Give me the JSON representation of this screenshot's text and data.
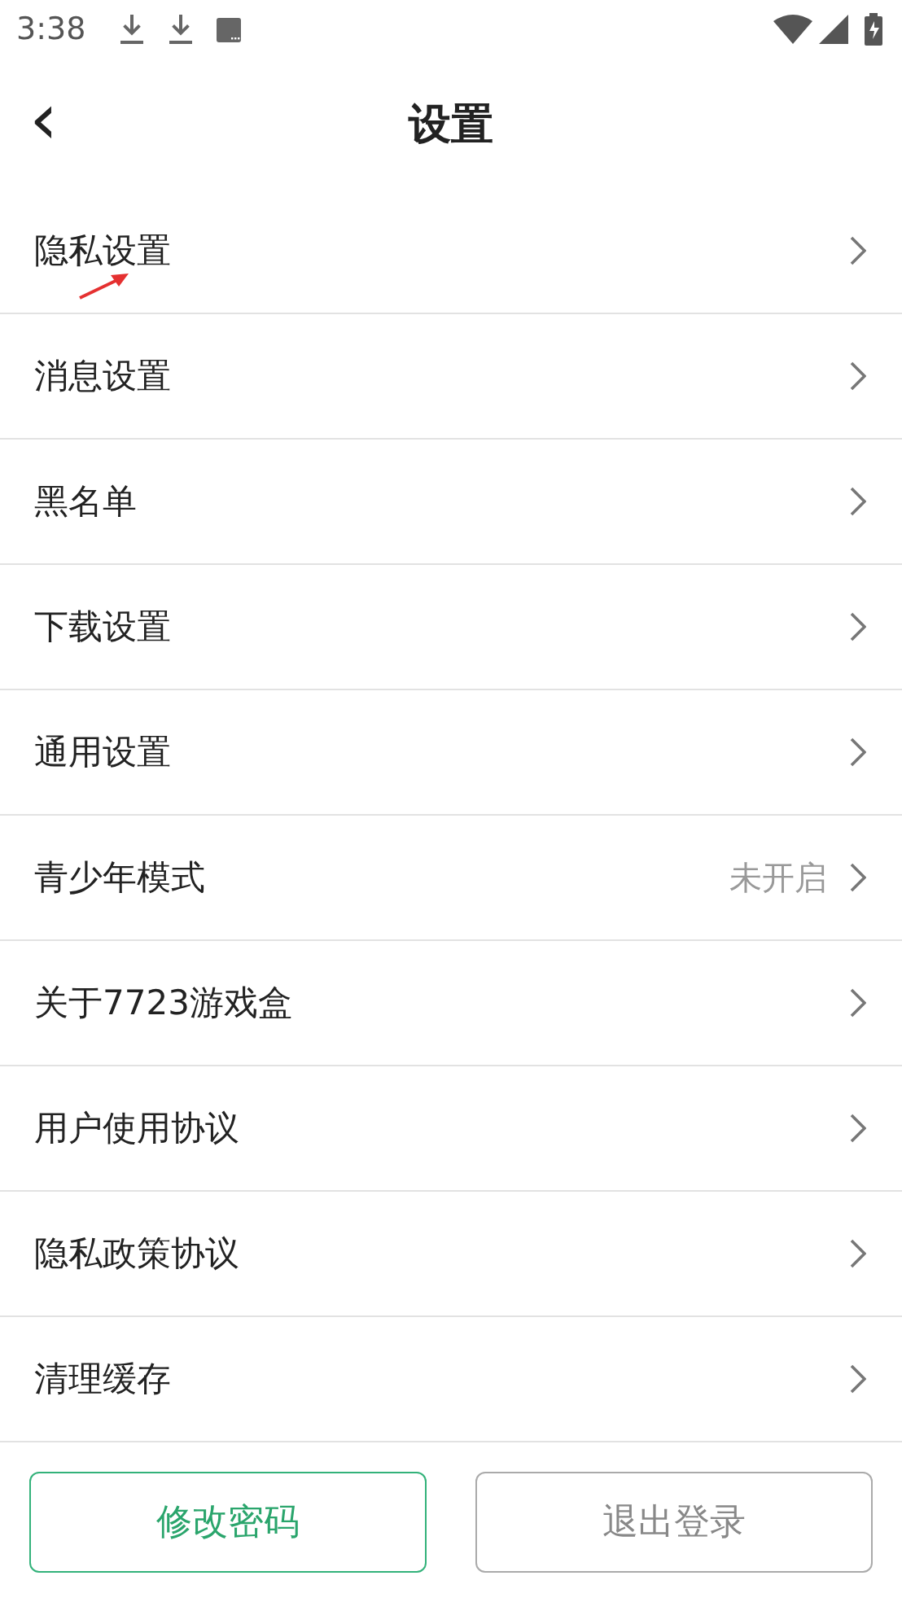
{
  "status_bar": {
    "time": "3:38"
  },
  "header": {
    "back": "‹",
    "title": "设置"
  },
  "items": [
    {
      "label": "隐私设置",
      "annotated": true
    },
    {
      "label": "消息设置",
      "annotated": false
    },
    {
      "label": "黑名单",
      "annotated": false
    },
    {
      "label": "下载设置",
      "annotated": false
    },
    {
      "label": "通用设置",
      "annotated": false
    },
    {
      "label": "青少年模式",
      "value": "未开启",
      "annotated": false
    },
    {
      "label": "关于7723游戏盒",
      "annotated": false
    },
    {
      "label": "用户使用协议",
      "annotated": false
    },
    {
      "label": "隐私政策协议",
      "annotated": false
    },
    {
      "label": "清理缓存",
      "annotated": false
    }
  ],
  "buttons": [
    {
      "label": "修改密码",
      "kind": "primary"
    },
    {
      "label": "退出登录",
      "kind": "secondary"
    }
  ]
}
